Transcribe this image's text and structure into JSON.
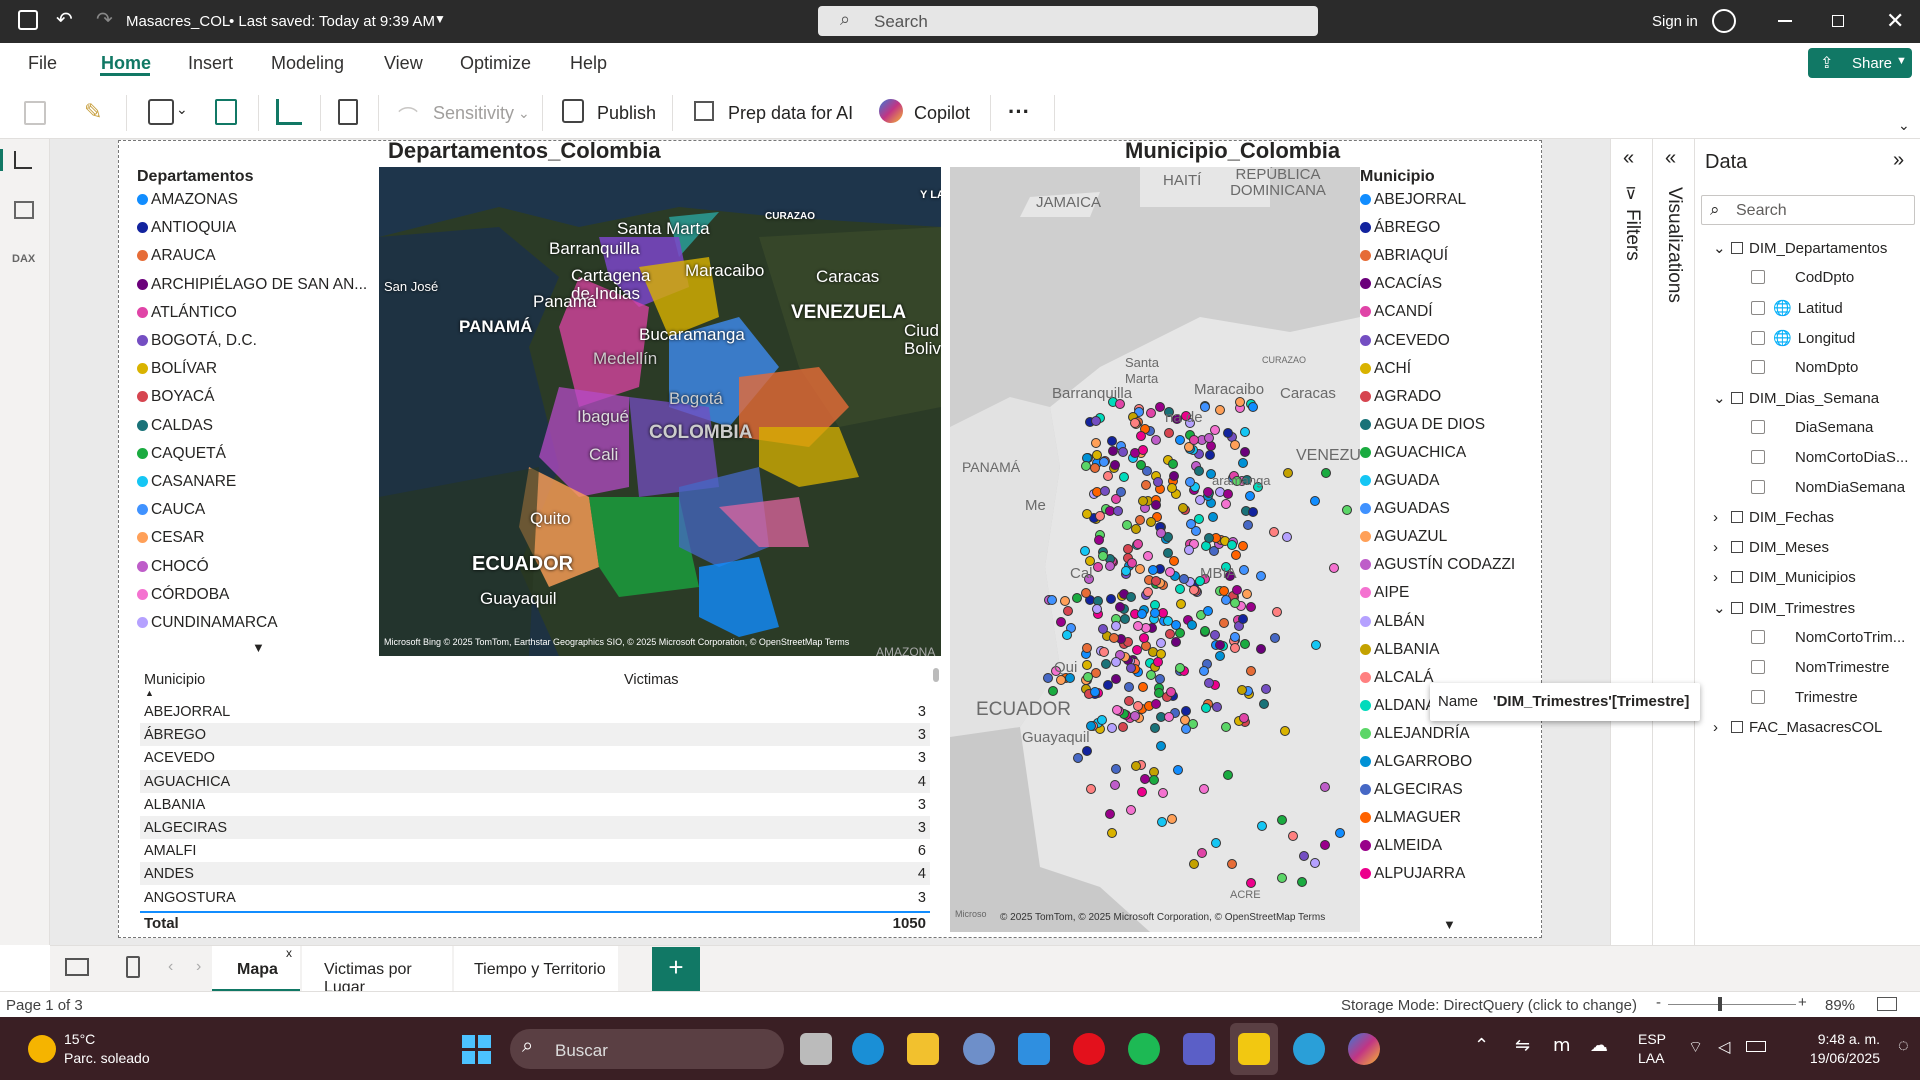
{
  "window": {
    "title": "Masacres_COL",
    "saved": "• Last saved: Today at 9:39 AM",
    "search_placeholder": "Search",
    "signin": "Sign in"
  },
  "menu": {
    "items": [
      "File",
      "Home",
      "Insert",
      "Modeling",
      "View",
      "Optimize",
      "Help"
    ],
    "share": "Share"
  },
  "ribbon": {
    "sensitivity": "Sensitivity",
    "publish": "Publish",
    "prep": "Prep data for AI",
    "copilot": "Copilot",
    "more": "···"
  },
  "visuals": {
    "dept_title": "Departamentos_Colombia",
    "mun_title": "Municipio_Colombia",
    "dept_legend_title": "Departamentos",
    "mun_legend_title": "Municipio",
    "dept_legend": [
      {
        "name": "AMAZONAS",
        "color": "#118dff"
      },
      {
        "name": "ANTIOQUIA",
        "color": "#12239e"
      },
      {
        "name": "ARAUCA",
        "color": "#e66c37"
      },
      {
        "name": "ARCHIPIÉLAGO DE SAN AN...",
        "color": "#6b007b"
      },
      {
        "name": "ATLÁNTICO",
        "color": "#e044a7"
      },
      {
        "name": "BOGOTÁ, D.C.",
        "color": "#744ec2"
      },
      {
        "name": "BOLÍVAR",
        "color": "#d9b300"
      },
      {
        "name": "BOYACÁ",
        "color": "#d64550"
      },
      {
        "name": "CALDAS",
        "color": "#197278"
      },
      {
        "name": "CAQUETÁ",
        "color": "#1aab40"
      },
      {
        "name": "CASANARE",
        "color": "#15c6f4"
      },
      {
        "name": "CAUCA",
        "color": "#4092ff"
      },
      {
        "name": "CESAR",
        "color": "#ffa058"
      },
      {
        "name": "CHOCÓ",
        "color": "#be5dc9"
      },
      {
        "name": "CÓRDOBA",
        "color": "#f472d0"
      },
      {
        "name": "CUNDINAMARCA",
        "color": "#b5a1ff"
      }
    ],
    "mun_legend": [
      {
        "name": "ABEJORRAL",
        "color": "#118dff"
      },
      {
        "name": "ÁBREGO",
        "color": "#12239e"
      },
      {
        "name": "ABRIAQUÍ",
        "color": "#e66c37"
      },
      {
        "name": "ACACÍAS",
        "color": "#6b007b"
      },
      {
        "name": "ACANDÍ",
        "color": "#e044a7"
      },
      {
        "name": "ACEVEDO",
        "color": "#744ec2"
      },
      {
        "name": "ACHÍ",
        "color": "#d9b300"
      },
      {
        "name": "AGRADO",
        "color": "#d64550"
      },
      {
        "name": "AGUA DE DIOS",
        "color": "#197278"
      },
      {
        "name": "AGUACHICA",
        "color": "#1aab40"
      },
      {
        "name": "AGUADA",
        "color": "#15c6f4"
      },
      {
        "name": "AGUADAS",
        "color": "#4092ff"
      },
      {
        "name": "AGUAZUL",
        "color": "#ffa058"
      },
      {
        "name": "AGUSTÍN CODAZZI",
        "color": "#be5dc9"
      },
      {
        "name": "AIPE",
        "color": "#f472d0"
      },
      {
        "name": "ALBÁN",
        "color": "#b5a1ff"
      },
      {
        "name": "ALBANIA",
        "color": "#c4a200"
      },
      {
        "name": "ALCALÁ",
        "color": "#ff8080"
      },
      {
        "name": "ALDANA",
        "color": "#00dbbc"
      },
      {
        "name": "ALEJANDRÍA",
        "color": "#5bd667"
      },
      {
        "name": "ALGARROBO",
        "color": "#0091d5"
      },
      {
        "name": "ALGECIRAS",
        "color": "#4668c5"
      },
      {
        "name": "ALMAGUER",
        "color": "#ff6300"
      },
      {
        "name": "ALMEIDA",
        "color": "#99008a"
      },
      {
        "name": "ALPUJARRA",
        "color": "#ec008c"
      }
    ],
    "map1_labels": [
      "Santa Marta",
      "Barranquilla",
      "Cartagena de Indias",
      "Maracaibo",
      "Caracas",
      "San José",
      "Panamá",
      "PANAMÁ",
      "VENEZUELA",
      "Ciud Boliv",
      "Bucaramanga",
      "Medellín",
      "Bogotá",
      "COLOMBIA",
      "Ibagué",
      "Cali",
      "Quito",
      "ECUADOR",
      "Guayaquil",
      "CURAZAO",
      "Y LA"
    ],
    "map1_credit": "Microsoft Bing  © 2025 TomTom, Earthstar Geographics SIO, © 2025 Microsoft Corporation, © OpenStreetMap  Terms",
    "map2_labels": [
      "JAMAICA",
      "HAITÍ",
      "REPÚBLICA DOMINICANA",
      "Santa Marta",
      "Barranquilla",
      "Maracaibo",
      "Caracas",
      "CURAZAO",
      "PANAMÁ",
      "VENEZU",
      "ECUADOR",
      "Guayaquil",
      "Qui",
      "ACRE",
      "aramanga",
      "Me",
      "Cal",
      "na de",
      "MBIA"
    ],
    "map2_credit": "© 2025 TomTom, © 2025 Microsoft Corporation, © OpenStreetMap  Terms",
    "map2_brand": "Microso",
    "map1_brand": "AMAZONA"
  },
  "table": {
    "headers": [
      "Municipio",
      "Victimas"
    ],
    "rows": [
      [
        "ABEJORRAL",
        "3"
      ],
      [
        "ÁBREGO",
        "3"
      ],
      [
        "ACEVEDO",
        "3"
      ],
      [
        "AGUACHICA",
        "4"
      ],
      [
        "ALBANIA",
        "3"
      ],
      [
        "ALGECIRAS",
        "3"
      ],
      [
        "AMALFI",
        "6"
      ],
      [
        "ANDES",
        "4"
      ],
      [
        "ANGOSTURA",
        "3"
      ]
    ],
    "total_label": "Total",
    "total_value": "1050"
  },
  "panes": {
    "filters": "Filters",
    "visualizations": "Visualizations",
    "data": "Data",
    "data_search": "Search"
  },
  "tree": [
    {
      "label": "DIM_Departamentos",
      "expanded": true,
      "children": [
        {
          "label": "CodDpto",
          "globe": false
        },
        {
          "label": "Latitud",
          "globe": true
        },
        {
          "label": "Longitud",
          "globe": true
        },
        {
          "label": "NomDpto",
          "globe": false
        }
      ]
    },
    {
      "label": "DIM_Dias_Semana",
      "expanded": true,
      "children": [
        {
          "label": "DiaSemana",
          "globe": false
        },
        {
          "label": "NomCortoDiaS...",
          "globe": false
        },
        {
          "label": "NomDiaSemana",
          "globe": false
        }
      ]
    },
    {
      "label": "DIM_Fechas",
      "expanded": false,
      "children": []
    },
    {
      "label": "DIM_Meses",
      "expanded": false,
      "children": []
    },
    {
      "label": "DIM_Municipios",
      "expanded": false,
      "children": []
    },
    {
      "label": "DIM_Trimestres",
      "expanded": true,
      "children": [
        {
          "label": "NomCortoTrim...",
          "globe": false
        },
        {
          "label": "NomTrimestre",
          "globe": false
        },
        {
          "label": "Trimestre",
          "globe": false
        }
      ]
    },
    {
      "label": "FAC_MasacresCOL",
      "expanded": false,
      "children": []
    }
  ],
  "tooltip": {
    "name_label": "Name",
    "name_value": "'DIM_Trimestres'[Trimestre]"
  },
  "tabs": {
    "items": [
      "Mapa",
      "Victimas por Lugar",
      "Tiempo y Territorio"
    ],
    "close": "x",
    "add": "+"
  },
  "status": {
    "page": "Page 1 of 3",
    "storage": "Storage Mode: DirectQuery (click to change)",
    "zoom": "89%"
  },
  "taskbar": {
    "temp": "15°C",
    "weather": "Parc. soleado",
    "search": "Buscar",
    "lang1": "ESP",
    "lang2": "LAA",
    "time": "9:48 a. m.",
    "date": "19/06/2025"
  }
}
